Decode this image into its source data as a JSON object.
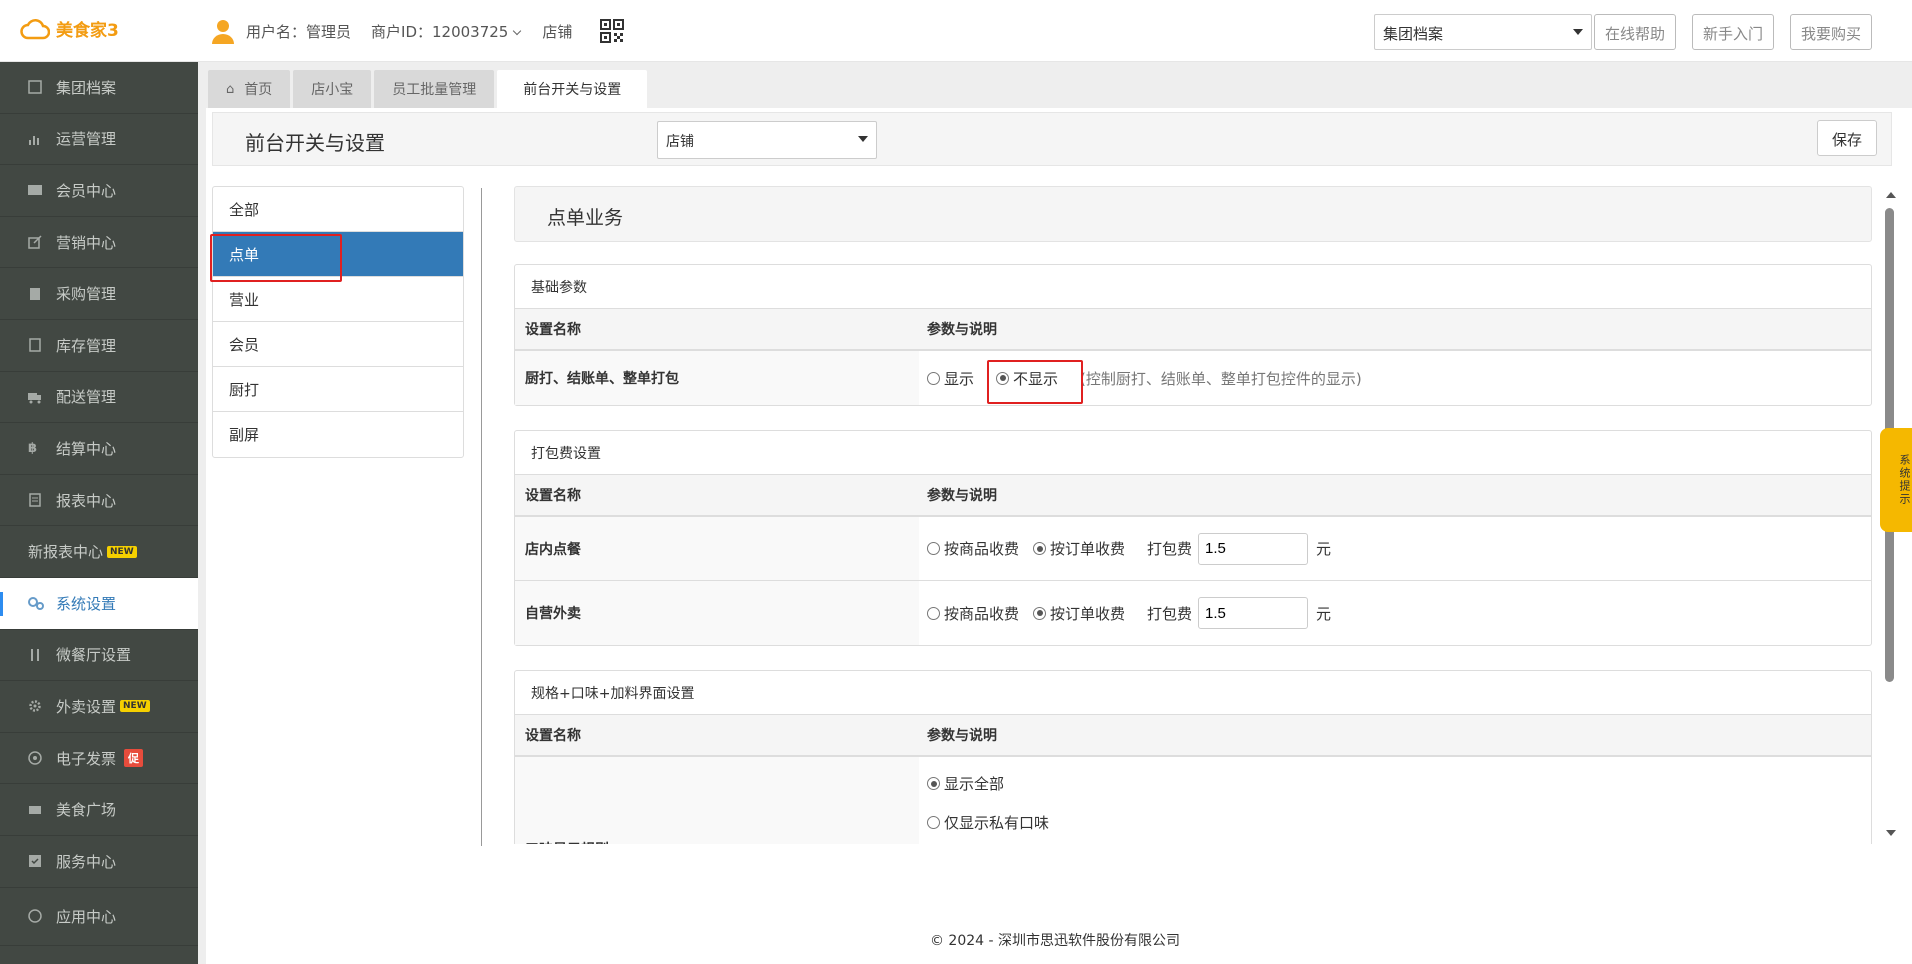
{
  "app": {
    "logo_text": "美食家3"
  },
  "topbar": {
    "username_label": "用户名：管理员",
    "merchant_label": "商户ID：12003725",
    "store_label": "店铺",
    "group_select": "集团档案",
    "help_button": "在线帮助",
    "newbie_button": "新手入门",
    "buy_button": "我要购买"
  },
  "sidebar": {
    "items": [
      {
        "label": "集团档案",
        "icon": "archive-icon"
      },
      {
        "label": "运营管理",
        "icon": "bar-chart-icon"
      },
      {
        "label": "会员中心",
        "icon": "member-card-icon"
      },
      {
        "label": "营销中心",
        "icon": "edit-icon"
      },
      {
        "label": "采购管理",
        "icon": "book-icon"
      },
      {
        "label": "库存管理",
        "icon": "warehouse-icon"
      },
      {
        "label": "配送管理",
        "icon": "truck-icon"
      },
      {
        "label": "结算中心",
        "icon": "bitcoin-icon"
      },
      {
        "label": "报表中心",
        "icon": "report-icon"
      },
      {
        "label": "新报表中心",
        "icon": "",
        "badge": "NEW"
      },
      {
        "label": "系统设置",
        "icon": "gears-icon"
      },
      {
        "label": "微餐厅设置",
        "icon": "cutlery-icon"
      },
      {
        "label": "外卖设置",
        "icon": "gear-icon",
        "badge": "NEW"
      },
      {
        "label": "电子发票",
        "icon": "invoice-icon",
        "badge": "促"
      },
      {
        "label": "美食广场",
        "icon": "food-icon"
      },
      {
        "label": "服务中心",
        "icon": "service-icon"
      },
      {
        "label": "应用中心",
        "icon": "app-icon"
      }
    ]
  },
  "tabs": [
    {
      "label": "首页",
      "icon": "home-icon"
    },
    {
      "label": "店小宝"
    },
    {
      "label": "员工批量管理"
    },
    {
      "label": "前台开关与设置"
    }
  ],
  "page": {
    "title": "前台开关与设置",
    "store_select": "店铺",
    "save_button": "保存"
  },
  "categories": [
    "全部",
    "点单",
    "营业",
    "会员",
    "厨打",
    "副屏"
  ],
  "section": {
    "title": "点单业务",
    "col_name": "设置名称",
    "col_param": "参数与说明"
  },
  "basic": {
    "heading": "基础参数",
    "row_name": "厨打、结账单、整单打包",
    "opt_show": "显示",
    "opt_hide": "不显示",
    "hint": "(控制厨打、结账单、整单打包控件的显示)"
  },
  "packing": {
    "heading": "打包费设置",
    "rows": [
      {
        "name": "店内点餐",
        "opt_goods": "按商品收费",
        "opt_order": "按订单收费",
        "fee_label": "打包费",
        "fee_value": "1.5",
        "unit": "元"
      },
      {
        "name": "自营外卖",
        "opt_goods": "按商品收费",
        "opt_order": "按订单收费",
        "fee_label": "打包费",
        "fee_value": "1.5",
        "unit": "元"
      }
    ]
  },
  "spec": {
    "heading": "规格+口味+加料界面设置",
    "row_name": "口味显示规则",
    "opt_all": "显示全部",
    "opt_private": "仅显示私有口味"
  },
  "system_tip": "系统提示",
  "footer": "© 2024 - 深圳市思迅软件股份有限公司"
}
